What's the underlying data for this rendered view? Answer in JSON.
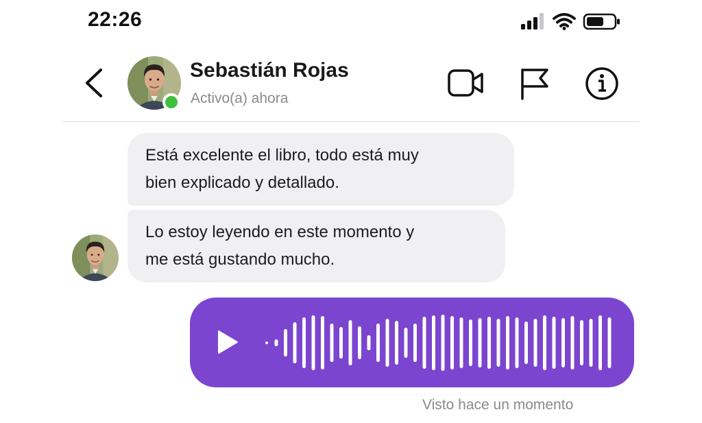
{
  "status_bar": {
    "time": "22:26",
    "icons": [
      "cellular-signal-icon",
      "wifi-icon",
      "battery-icon"
    ]
  },
  "header": {
    "contact_name": "Sebastián Rojas",
    "contact_status": "Activo(a) ahora",
    "online_color": "#3fbf3c",
    "actions": [
      "back-chevron-icon",
      "video-call-icon",
      "report-flag-icon",
      "info-icon"
    ]
  },
  "messages": [
    {
      "direction": "incoming",
      "lines": [
        "Está excelente el libro, todo está muy",
        "bien explicado y detallado."
      ]
    },
    {
      "direction": "incoming",
      "lines": [
        "Lo estoy leyendo en este momento y",
        "me está gustando mucho."
      ]
    }
  ],
  "voice_message": {
    "direction": "outgoing",
    "color": "#7b45cf",
    "icon": "play-icon"
  },
  "receipt": {
    "text": "Visto hace un momento"
  }
}
